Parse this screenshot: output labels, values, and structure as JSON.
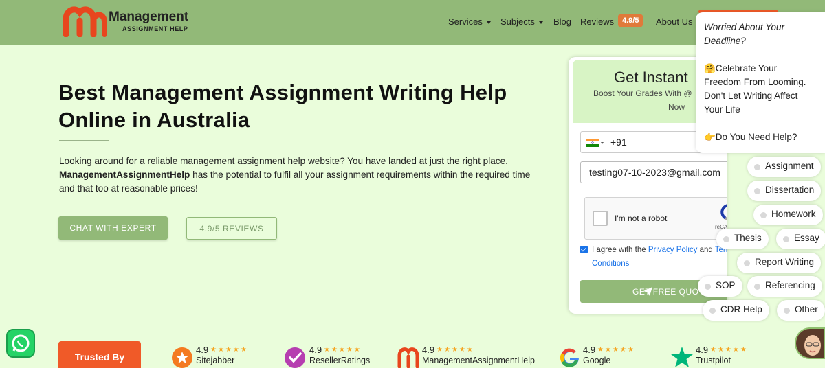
{
  "header": {
    "logo_title": "Management",
    "logo_subtitle": "ASSIGNMENT HELP",
    "nav": [
      {
        "label": "Services",
        "dropdown": true
      },
      {
        "label": "Subjects",
        "dropdown": true
      },
      {
        "label": "Blog",
        "dropdown": false
      },
      {
        "label": "Reviews",
        "dropdown": false
      },
      {
        "label": "About Us",
        "dropdown": false
      }
    ],
    "rating_badge": "4.9/5",
    "accent_color": "#92b978",
    "brand_color": "#f05a28"
  },
  "hero": {
    "title": "Best Management Assignment Writing Help Online in Australia",
    "desc_part1": "Looking around for a reliable management assignment help website? You have landed at just the right place. ",
    "desc_bold": "ManagementAssignmentHelp",
    "desc_part2": " has the potential to fulfil all your assignment requirements within the required time and that too at reasonable prices!",
    "chat_button": "CHAT WITH EXPERT",
    "reviews_button": "4.9/5 REVIEWS"
  },
  "form": {
    "title": "Get Instant",
    "subtitle": "Boost Your Grades With @",
    "subtitle2": "Now",
    "phone_code": "+91",
    "email_value": "testing07-10-2023@gmail.com",
    "captcha_label": "I'm not a robot",
    "captcha_brand": "reCAPTCHA",
    "agree_prefix": "I agree with the ",
    "privacy_link": "Privacy Policy",
    "agree_and": " and ",
    "terms_link": "Terms & Conditions",
    "agree_checked": true,
    "submit_label": "GET FREE QUO"
  },
  "popup": {
    "line1": "Worried About Your",
    "line2": "Deadline?",
    "line3": "🤗Celebrate Your",
    "line4": "Freedom From Looming.",
    "line5": "Don't Let Writing Affect",
    "line6": "Your Life",
    "line7": "👉Do You Need Help?"
  },
  "chips": [
    "Assignment",
    "Dissertation",
    "Homework",
    "Thesis",
    "Essay",
    "Report Writing",
    "SOP",
    "Referencing",
    "CDR Help",
    "Other"
  ],
  "trusted": {
    "label": "Trusted By",
    "reviews": [
      {
        "score": "4.9",
        "name": "Sitejabber",
        "icon": "sitejabber-icon"
      },
      {
        "score": "4.9",
        "name": "ResellerRatings",
        "icon": "resellerratings-icon"
      },
      {
        "score": "4.9",
        "name": "ManagementAssignmentHelp",
        "icon": "mah-logo-icon"
      },
      {
        "score": "4.9",
        "name": "Google",
        "icon": "google-icon"
      },
      {
        "score": "4.9",
        "name": "Trustpilot",
        "icon": "trustpilot-icon"
      }
    ],
    "stars": "★★★★★"
  },
  "widgets": {
    "whatsapp_icon": "whatsapp-icon",
    "avatar": "support-agent-avatar"
  }
}
